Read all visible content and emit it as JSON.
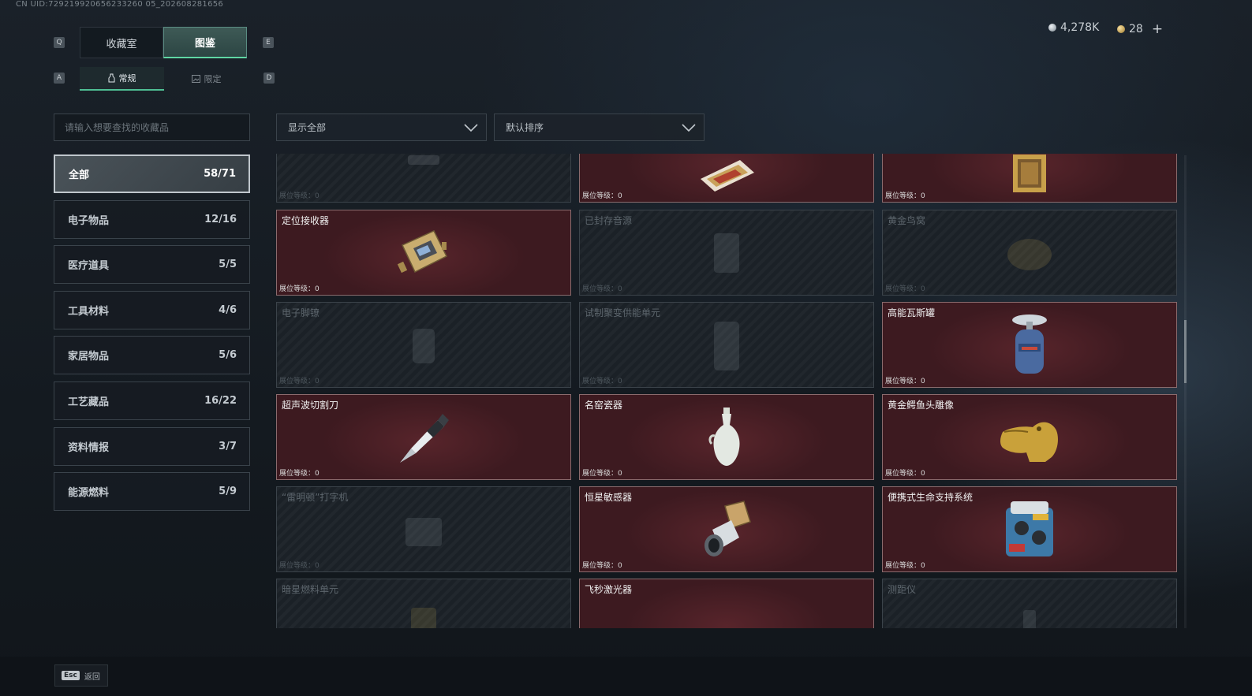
{
  "header": {
    "uid": "CN UID:729219920656233260 05_202608281656",
    "currency_silver": "4,278K",
    "currency_gold": "28",
    "plus": "+"
  },
  "main_tabs": {
    "prev_key": "Q",
    "next_key": "E",
    "items": [
      {
        "label": "收藏室",
        "active": false
      },
      {
        "label": "图鉴",
        "active": true
      }
    ]
  },
  "sub_tabs": {
    "prev_key": "A",
    "next_key": "D",
    "items": [
      {
        "label": "常规",
        "active": true
      },
      {
        "label": "限定",
        "active": false
      }
    ]
  },
  "search": {
    "placeholder": "请输入想要查找的收藏品",
    "value": ""
  },
  "filters": {
    "show": "显示全部",
    "sort": "默认排序"
  },
  "categories": [
    {
      "label": "全部",
      "count": "58/71"
    },
    {
      "label": "电子物品",
      "count": "12/16"
    },
    {
      "label": "医疗道具",
      "count": "5/5"
    },
    {
      "label": "工具材料",
      "count": "4/6"
    },
    {
      "label": "家居物品",
      "count": "5/6"
    },
    {
      "label": "工艺藏品",
      "count": "16/22"
    },
    {
      "label": "资料情报",
      "count": "3/7"
    },
    {
      "label": "能源燃料",
      "count": "5/9"
    }
  ],
  "level_prefix": "展位等级：",
  "items": [
    {
      "name": "",
      "owned": false,
      "level": "0",
      "icon": "tool-icon"
    },
    {
      "name": "",
      "owned": true,
      "level": "0",
      "icon": "document-icon"
    },
    {
      "name": "",
      "owned": true,
      "level": "0",
      "icon": "painting-icon"
    },
    {
      "name": "定位接收器",
      "owned": true,
      "level": "0",
      "icon": "receiver-icon"
    },
    {
      "name": "已封存音源",
      "owned": false,
      "level": "0",
      "icon": "audio-icon"
    },
    {
      "name": "黄金鸟窝",
      "owned": false,
      "level": "0",
      "icon": "nest-icon"
    },
    {
      "name": "电子脚镣",
      "owned": false,
      "level": "0",
      "icon": "shackle-icon"
    },
    {
      "name": "试制聚变供能单元",
      "owned": false,
      "level": "0",
      "icon": "fusion-cell-icon"
    },
    {
      "name": "高能瓦斯罐",
      "owned": true,
      "level": "0",
      "icon": "gas-tank-icon"
    },
    {
      "name": "超声波切割刀",
      "owned": true,
      "level": "0",
      "icon": "cutter-icon"
    },
    {
      "name": "名窑瓷器",
      "owned": true,
      "level": "0",
      "icon": "vase-icon"
    },
    {
      "name": "黄金鳄鱼头雕像",
      "owned": true,
      "level": "0",
      "icon": "croc-statue-icon"
    },
    {
      "name": "“雷明顿”打字机",
      "owned": false,
      "level": "0",
      "icon": "typewriter-icon"
    },
    {
      "name": "恒星敏感器",
      "owned": true,
      "level": "0",
      "icon": "star-sensor-icon"
    },
    {
      "name": "便携式生命支持系统",
      "owned": true,
      "level": "0",
      "icon": "life-support-icon"
    },
    {
      "name": "暗星燃料单元",
      "owned": false,
      "level": "",
      "icon": "fuel-cell-icon"
    },
    {
      "name": "飞秒激光器",
      "owned": true,
      "level": "",
      "icon": "laser-icon"
    },
    {
      "name": "测距仪",
      "owned": false,
      "level": "",
      "icon": "rangefinder-icon"
    }
  ],
  "footer": {
    "esc_key": "Esc",
    "esc_label": "返回"
  },
  "colors": {
    "accent": "#5fd6a3",
    "owned_card": "#3d1a20",
    "locked_card": "#1b2127"
  }
}
